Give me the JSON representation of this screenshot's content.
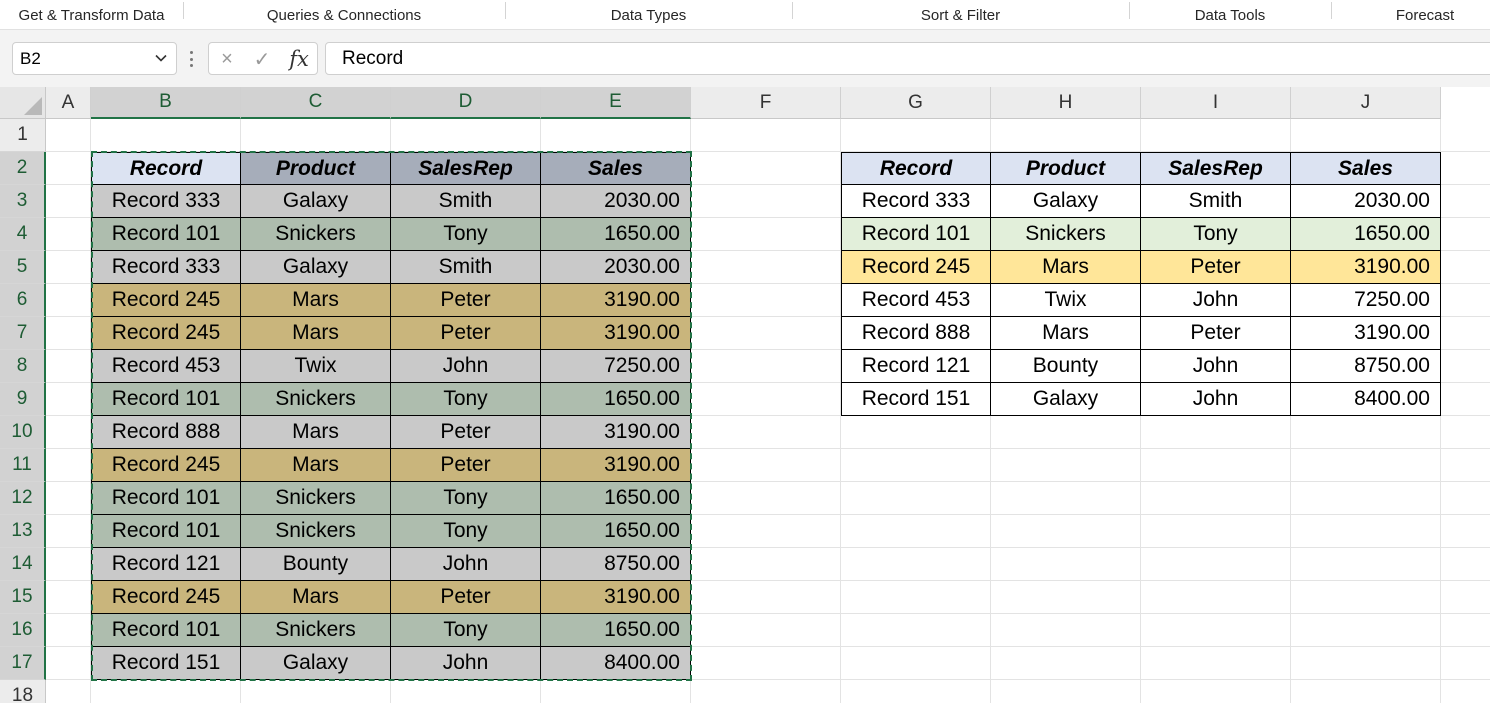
{
  "ribbon": {
    "groups": [
      "Get & Transform Data",
      "Queries & Connections",
      "Data Types",
      "Sort & Filter",
      "Data Tools",
      "Forecast"
    ]
  },
  "formula_bar": {
    "name_box": "B2",
    "cancel_icon": "×",
    "enter_icon": "✓",
    "fx_label": "fx",
    "formula": "Record"
  },
  "columns": [
    "A",
    "B",
    "C",
    "D",
    "E",
    "F",
    "G",
    "H",
    "I",
    "J"
  ],
  "rows": [
    "1",
    "2",
    "3",
    "4",
    "5",
    "6",
    "7",
    "8",
    "9",
    "10",
    "11",
    "12",
    "13",
    "14",
    "15",
    "16",
    "17",
    "18"
  ],
  "selection": {
    "active_cell": "B2",
    "selected_columns": [
      "B",
      "C",
      "D",
      "E"
    ],
    "selected_rows": [
      "2",
      "3",
      "4",
      "5",
      "6",
      "7",
      "8",
      "9",
      "10",
      "11",
      "12",
      "13",
      "14",
      "15",
      "16",
      "17"
    ]
  },
  "colors": {
    "accent": "#217346",
    "header_fill": "#A6ADBA",
    "header_fill_first": "#DCE3F2",
    "gray_fill": "#C9C9C9",
    "green_fill": "#AEBDAE",
    "gold_fill": "#C9B57C",
    "light_green_fill": "#E2EFDA",
    "light_gold_fill": "#FFE699",
    "white_fill": "#FFFFFF"
  },
  "source_table": {
    "headers": [
      "Record",
      "Product",
      "SalesRep",
      "Sales"
    ],
    "rows": [
      {
        "cells": [
          "Record 333",
          "Galaxy",
          "Smith",
          "2030.00"
        ],
        "fill": "gray"
      },
      {
        "cells": [
          "Record 101",
          "Snickers",
          "Tony",
          "1650.00"
        ],
        "fill": "green"
      },
      {
        "cells": [
          "Record 333",
          "Galaxy",
          "Smith",
          "2030.00"
        ],
        "fill": "gray"
      },
      {
        "cells": [
          "Record 245",
          "Mars",
          "Peter",
          "3190.00"
        ],
        "fill": "gold"
      },
      {
        "cells": [
          "Record 245",
          "Mars",
          "Peter",
          "3190.00"
        ],
        "fill": "gold"
      },
      {
        "cells": [
          "Record 453",
          "Twix",
          "John",
          "7250.00"
        ],
        "fill": "gray"
      },
      {
        "cells": [
          "Record 101",
          "Snickers",
          "Tony",
          "1650.00"
        ],
        "fill": "green"
      },
      {
        "cells": [
          "Record 888",
          "Mars",
          "Peter",
          "3190.00"
        ],
        "fill": "gray"
      },
      {
        "cells": [
          "Record 245",
          "Mars",
          "Peter",
          "3190.00"
        ],
        "fill": "gold"
      },
      {
        "cells": [
          "Record 101",
          "Snickers",
          "Tony",
          "1650.00"
        ],
        "fill": "green"
      },
      {
        "cells": [
          "Record 101",
          "Snickers",
          "Tony",
          "1650.00"
        ],
        "fill": "green"
      },
      {
        "cells": [
          "Record 121",
          "Bounty",
          "John",
          "8750.00"
        ],
        "fill": "gray"
      },
      {
        "cells": [
          "Record 245",
          "Mars",
          "Peter",
          "3190.00"
        ],
        "fill": "gold"
      },
      {
        "cells": [
          "Record 101",
          "Snickers",
          "Tony",
          "1650.00"
        ],
        "fill": "green"
      },
      {
        "cells": [
          "Record 151",
          "Galaxy",
          "John",
          "8400.00"
        ],
        "fill": "gray"
      }
    ]
  },
  "result_table": {
    "headers": [
      "Record",
      "Product",
      "SalesRep",
      "Sales"
    ],
    "rows": [
      {
        "cells": [
          "Record 333",
          "Galaxy",
          "Smith",
          "2030.00"
        ],
        "fill": "white"
      },
      {
        "cells": [
          "Record 101",
          "Snickers",
          "Tony",
          "1650.00"
        ],
        "fill": "light_green"
      },
      {
        "cells": [
          "Record 245",
          "Mars",
          "Peter",
          "3190.00"
        ],
        "fill": "light_gold"
      },
      {
        "cells": [
          "Record 453",
          "Twix",
          "John",
          "7250.00"
        ],
        "fill": "white"
      },
      {
        "cells": [
          "Record 888",
          "Mars",
          "Peter",
          "3190.00"
        ],
        "fill": "white"
      },
      {
        "cells": [
          "Record 121",
          "Bounty",
          "John",
          "8750.00"
        ],
        "fill": "white"
      },
      {
        "cells": [
          "Record 151",
          "Galaxy",
          "John",
          "8400.00"
        ],
        "fill": "white"
      }
    ]
  }
}
